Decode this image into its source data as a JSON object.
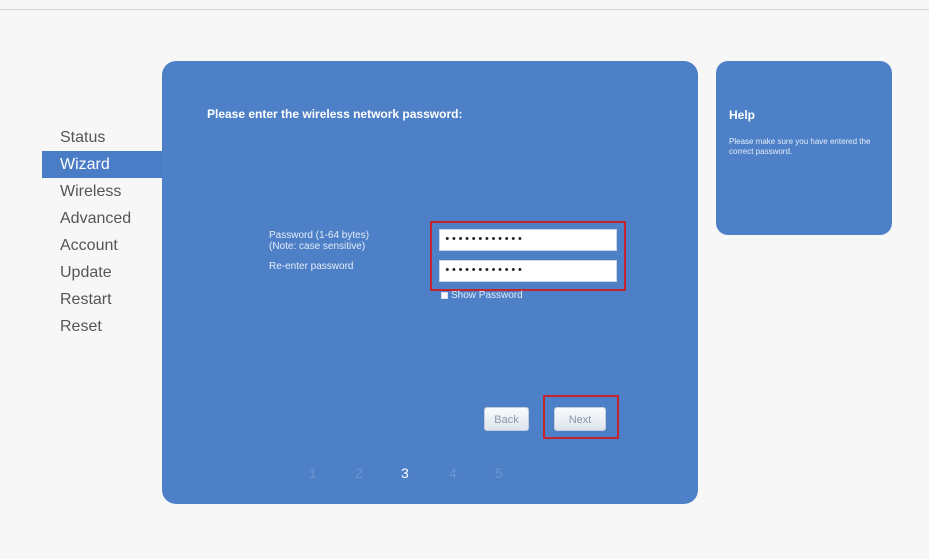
{
  "nav": {
    "items": [
      {
        "label": "Status",
        "active": false
      },
      {
        "label": "Wizard",
        "active": true
      },
      {
        "label": "Wireless",
        "active": false
      },
      {
        "label": "Advanced",
        "active": false
      },
      {
        "label": "Account",
        "active": false
      },
      {
        "label": "Update",
        "active": false
      },
      {
        "label": "Restart",
        "active": false
      },
      {
        "label": "Reset",
        "active": false
      }
    ]
  },
  "wizard": {
    "title": "Please enter the wireless network password:",
    "password_label": "Password (1-64 bytes)",
    "password_note": "(Note: case sensitive)",
    "reenter_label": "Re-enter password",
    "password_value": "••••••••••••",
    "reenter_value": "••••••••••••",
    "show_password_label": "Show Password",
    "back_label": "Back",
    "next_label": "Next",
    "steps": [
      "1",
      "2",
      "3",
      "4",
      "5"
    ],
    "current_step": "3"
  },
  "help": {
    "title": "Help",
    "text": "Please make sure you have entered the correct password."
  },
  "colors": {
    "panel": "#4e80c8",
    "active_nav": "#4b7cc6",
    "highlight": "#c4242a"
  }
}
